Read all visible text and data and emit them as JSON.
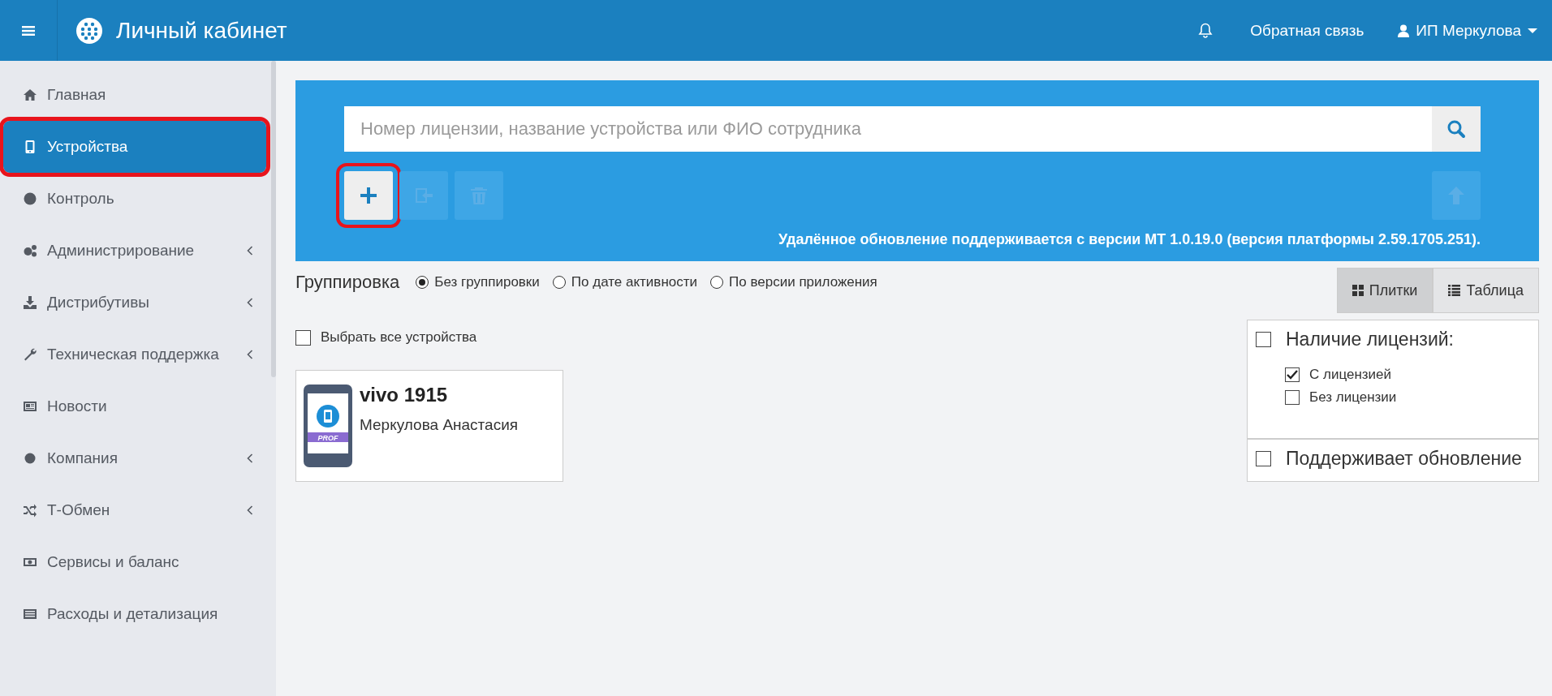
{
  "header": {
    "title": "Личный кабинет",
    "feedback": "Обратная связь",
    "user": "ИП Меркулова"
  },
  "sidebar": {
    "items": [
      {
        "label": "Главная",
        "expandable": false,
        "selected": false
      },
      {
        "label": "Устройства",
        "expandable": false,
        "selected": true
      },
      {
        "label": "Контроль",
        "expandable": false,
        "selected": false
      },
      {
        "label": "Администрирование",
        "expandable": true,
        "selected": false
      },
      {
        "label": "Дистрибутивы",
        "expandable": true,
        "selected": false
      },
      {
        "label": "Техническая поддержка",
        "expandable": true,
        "selected": false
      },
      {
        "label": "Новости",
        "expandable": false,
        "selected": false
      },
      {
        "label": "Компания",
        "expandable": true,
        "selected": false
      },
      {
        "label": "Т-Обмен",
        "expandable": true,
        "selected": false
      },
      {
        "label": "Сервисы и баланс",
        "expandable": false,
        "selected": false
      },
      {
        "label": "Расходы и детализация",
        "expandable": false,
        "selected": false
      }
    ]
  },
  "search": {
    "placeholder": "Номер лицензии, название устройства или ФИО сотрудника"
  },
  "toolbar": [
    {
      "kind": "add",
      "disabled": false,
      "highlighted": true
    },
    {
      "kind": "import",
      "disabled": true,
      "highlighted": false
    },
    {
      "kind": "delete",
      "disabled": true,
      "highlighted": false
    },
    {
      "kind": "upload",
      "disabled": true,
      "highlighted": false
    }
  ],
  "update_note": "Удалённое обновление поддерживается с версии МТ 1.0.19.0 (версия платформы 2.59.1705.251).",
  "grouping": {
    "label": "Группировка",
    "options": [
      {
        "label": "Без группировки",
        "selected": true
      },
      {
        "label": "По дате активности",
        "selected": false
      },
      {
        "label": "По версии приложения",
        "selected": false
      }
    ]
  },
  "view_toggle": [
    {
      "kind": "tiles",
      "label": "Плитки",
      "selected": true
    },
    {
      "kind": "table",
      "label": "Таблица",
      "selected": false
    }
  ],
  "select_all": {
    "label": "Выбрать все устройства",
    "checked": false
  },
  "devices": [
    {
      "name": "vivo 1915",
      "owner": "Меркулова Анастасия",
      "badge": "PROF"
    }
  ],
  "filters": [
    {
      "label": "Наличие лицензий:",
      "checked": false,
      "options": [
        {
          "label": "С лицензией",
          "checked": true
        },
        {
          "label": "Без лицензии",
          "checked": false
        }
      ]
    },
    {
      "label": "Поддерживает обновление",
      "checked": false
    }
  ]
}
